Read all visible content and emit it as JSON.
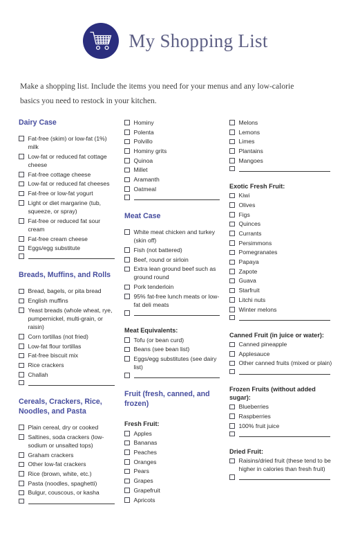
{
  "header": {
    "title": "My Shopping List",
    "icon": "shopping-cart-icon",
    "badge_color": "#2b2e7e",
    "title_color": "#5d5f84"
  },
  "intro": "Make a shopping list. Include the items you need for your menus and any low-calorie basics you need to restock in your kitchen.",
  "accent_color": "#464d9e",
  "columns": [
    {
      "sections": [
        {
          "title": "Dairy Case",
          "level": "section",
          "items": [
            "Fat-free (skim) or low-fat (1%) milk",
            "Low-fat or reduced fat cottage cheese",
            "Fat-free cottage cheese",
            "Low-fat or reduced fat cheeses",
            "Fat-free or low-fat yogurt",
            "Light or diet margarine (tub, squeeze, or spray)",
            "Fat-free or reduced fat sour cream",
            "Fat-free cream cheese",
            "Eggs/egg substitute"
          ],
          "blank_line": true
        },
        {
          "title": "Breads, Muffins, and Rolls",
          "level": "section",
          "items": [
            "Bread, bagels, or pita bread",
            "English muffins",
            "Yeast breads (whole wheat, rye, pumpernickel, multi-grain, or raisin)",
            "Corn tortillas (not fried)",
            "Low-fat flour tortillas",
            "Fat-free biscuit mix",
            "Rice crackers",
            "Challah"
          ],
          "blank_line": true
        },
        {
          "title": "Cereals, Crackers, Rice, Noodles, and Pasta",
          "level": "section",
          "items": [
            "Plain cereal, dry or cooked",
            "Saltines, soda crackers (low-sodium or unsalted tops)",
            "Graham crackers",
            "Other low-fat crackers",
            "Rice (brown, white, etc.)",
            "Pasta (noodles, spaghetti)",
            "Bulgur, couscous, or kasha"
          ],
          "blank_line": true
        }
      ]
    },
    {
      "sections": [
        {
          "title": "",
          "level": "none",
          "items": [
            "Hominy",
            "Polenta",
            "Polvillo",
            "Hominy grits",
            "Quinoa",
            "Millet",
            "Aramanth",
            "Oatmeal"
          ],
          "blank_line": true
        },
        {
          "title": "Meat Case",
          "level": "section",
          "items": [
            "White meat chicken and turkey (skin off)",
            "Fish (not battered)",
            "Beef, round or sirloin",
            "Extra lean ground beef such as ground round",
            "Pork tenderloin",
            "95% fat-free lunch meats or low-fat deli meats"
          ],
          "blank_line": true
        },
        {
          "title": "Meat Equivalents:",
          "level": "sub",
          "items": [
            "Tofu (or bean curd)",
            "Beans (see bean list)",
            "Eggs/egg substitutes (see dairy list)"
          ],
          "blank_line": true
        },
        {
          "title": "Fruit (fresh, canned, and frozen)",
          "level": "section",
          "items": [],
          "blank_line": false
        },
        {
          "title": "Fresh Fruit:",
          "level": "sub",
          "items": [
            "Apples",
            "Bananas",
            "Peaches",
            "Oranges",
            "Pears",
            "Grapes",
            "Grapefruit",
            "Apricots"
          ],
          "blank_line": false
        }
      ]
    },
    {
      "sections": [
        {
          "title": "",
          "level": "none",
          "items": [
            "Melons",
            "Lemons",
            "Limes",
            "Plantains",
            "Mangoes"
          ],
          "blank_line": true
        },
        {
          "title": "Exotic Fresh Fruit:",
          "level": "sub",
          "items": [
            "Kiwi",
            "Olives",
            "Figs",
            "Quinces",
            "Currants",
            "Persimmons",
            "Pomegranates",
            "Papaya",
            "Zapote",
            "Guava",
            "Starfruit",
            "Litchi nuts",
            "Winter melons"
          ],
          "blank_line": true
        },
        {
          "title": "Canned Fruit (in juice or water):",
          "level": "sub",
          "items": [
            "Canned pineapple",
            "Applesauce",
            "Other canned fruits (mixed or plain)"
          ],
          "blank_line": true
        },
        {
          "title": "Frozen Fruits (without added sugar):",
          "level": "sub",
          "items": [
            "Blueberries",
            "Raspberries",
            "100% fruit juice"
          ],
          "blank_line": true
        },
        {
          "title": "Dried Fruit:",
          "level": "sub",
          "items": [
            "Raisins/dried fruit (these tend to be higher in calories than fresh fruit)"
          ],
          "blank_line": true
        }
      ]
    }
  ]
}
